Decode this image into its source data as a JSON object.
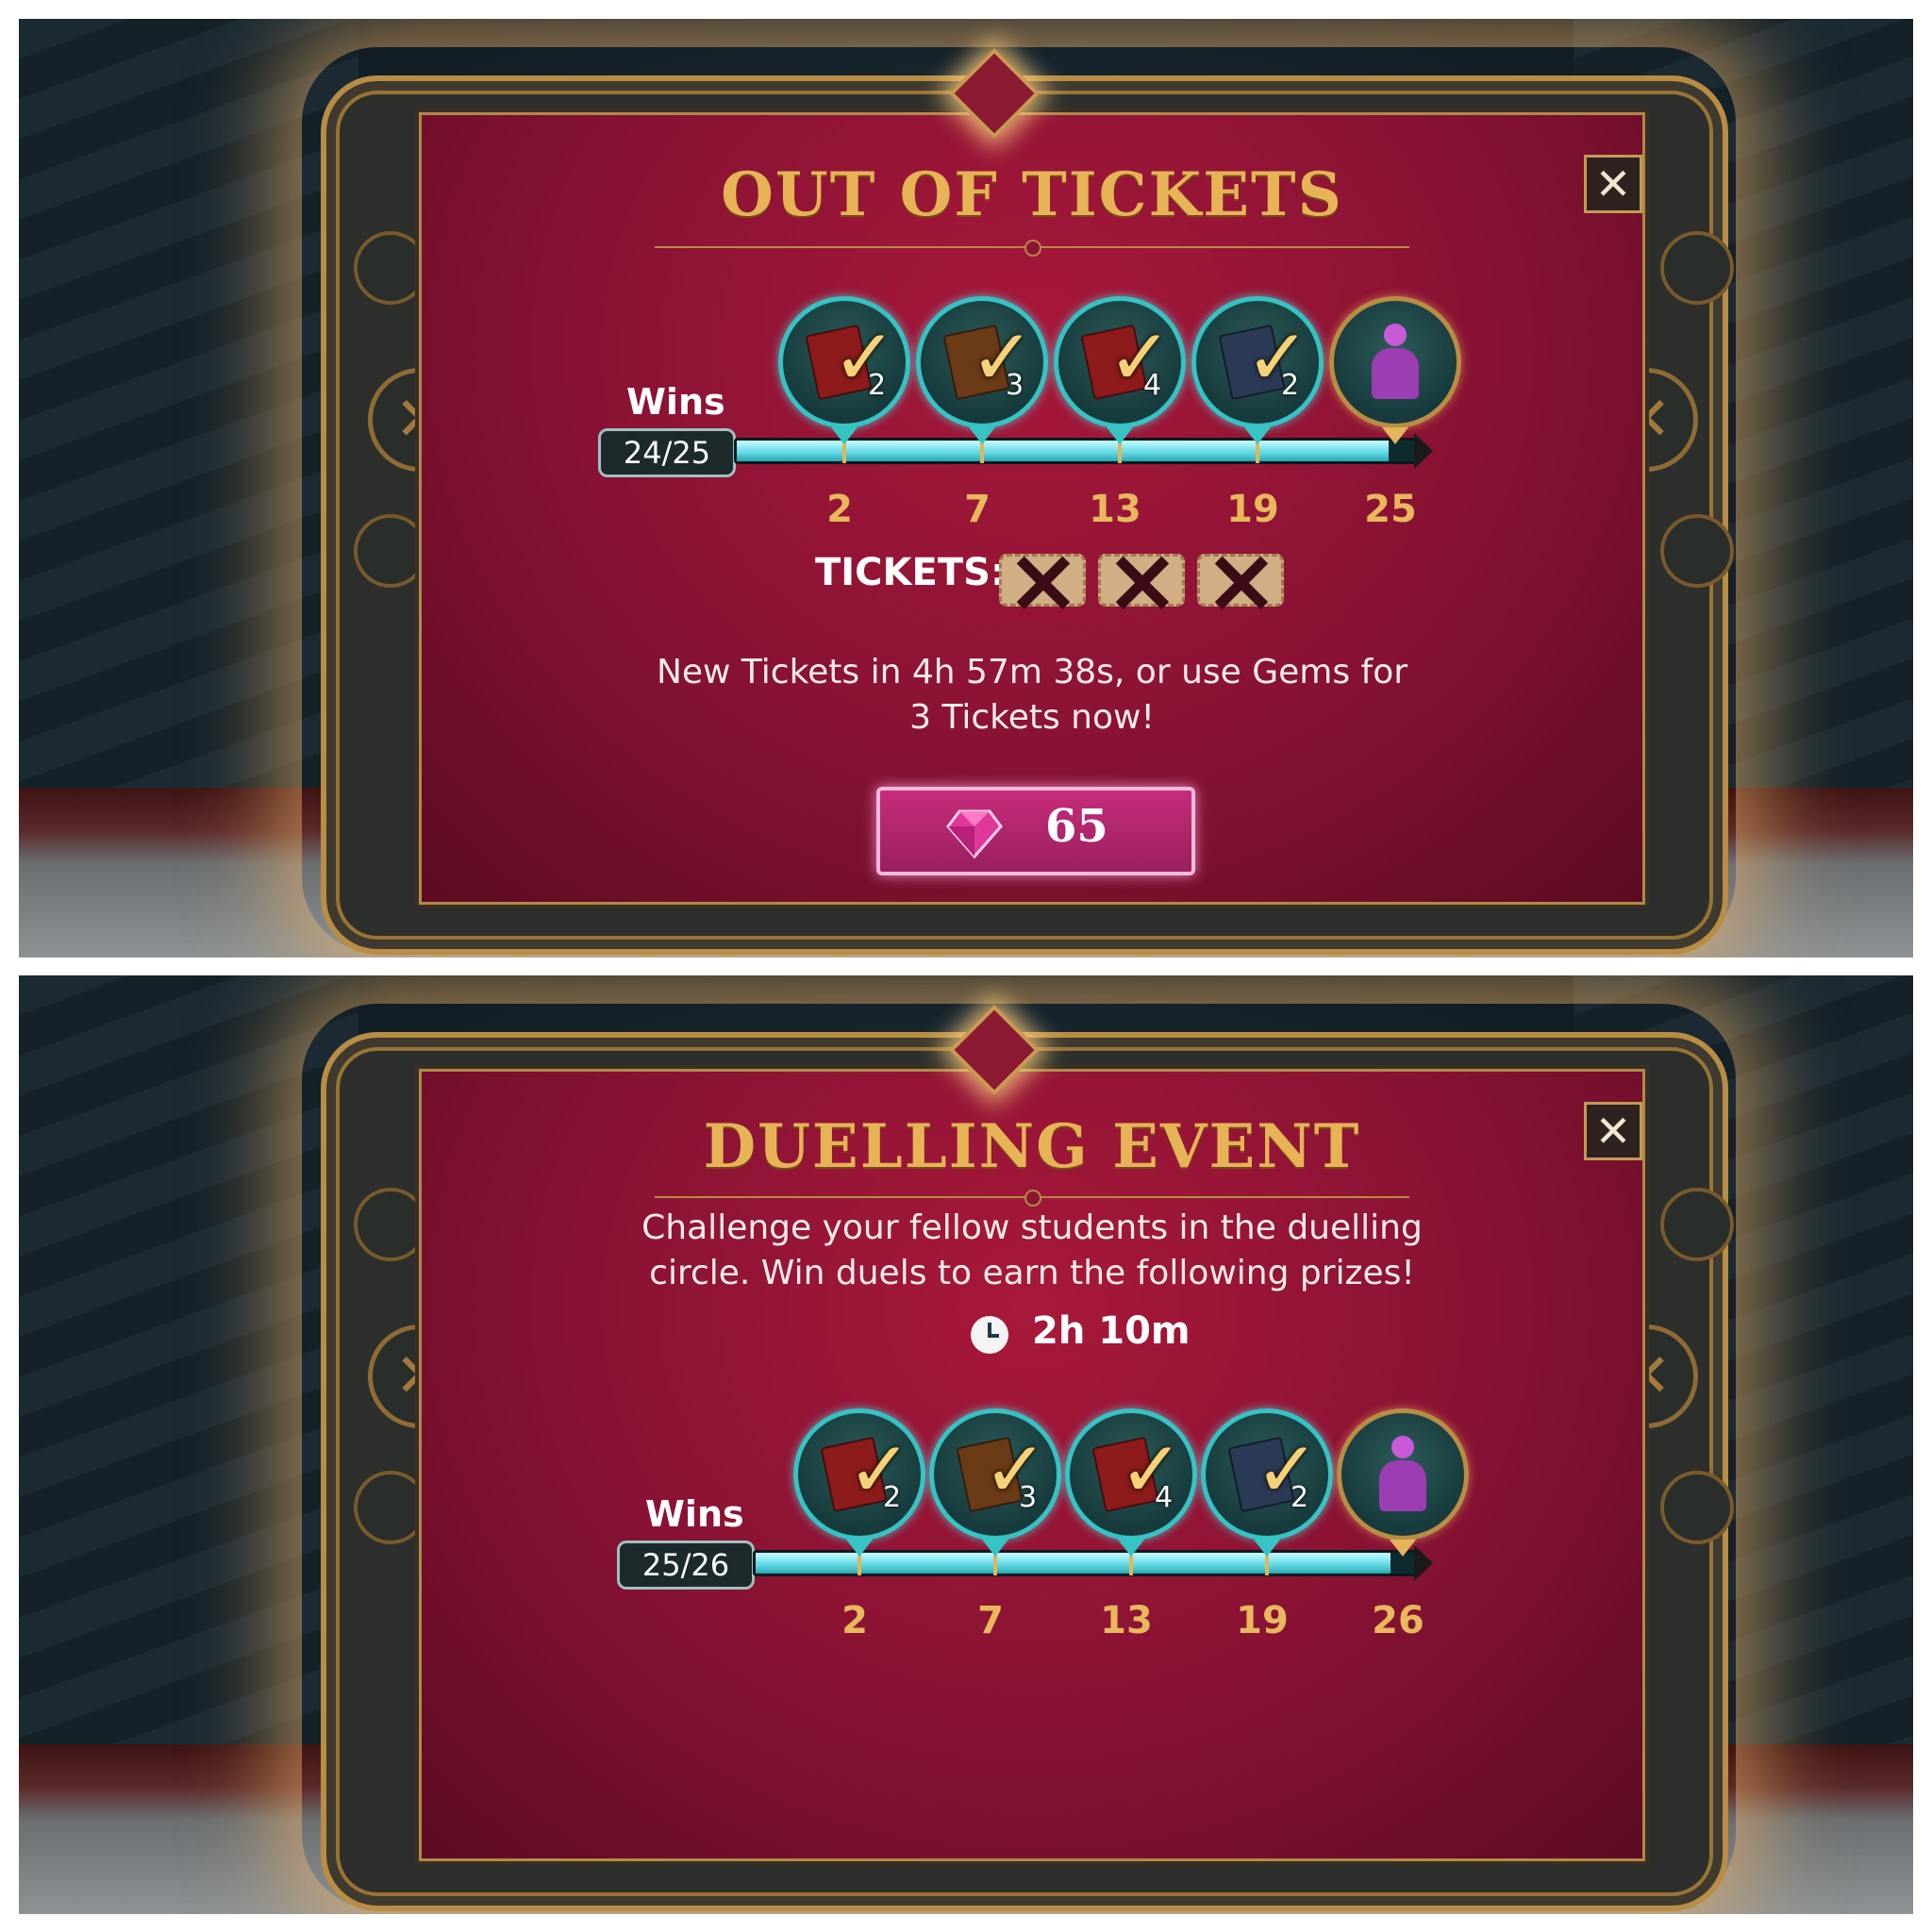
{
  "screens": [
    {
      "title": "OUT OF TICKETS",
      "close_label": "✕",
      "wins_label": "Wins",
      "wins_value": "24/25",
      "progress_fraction": 0.96,
      "milestones": [
        "2",
        "7",
        "13",
        "19",
        "25"
      ],
      "rewards": [
        {
          "count": "2",
          "icon": "red-book-check-icon",
          "color": "#8d1b1b"
        },
        {
          "count": "3",
          "icon": "brown-book-check-icon",
          "color": "#6b3a17"
        },
        {
          "count": "4",
          "icon": "red-book-check-icon",
          "color": "#8d1b1b"
        },
        {
          "count": "2",
          "icon": "blue-book-check-icon",
          "color": "#2b3a55"
        },
        {
          "icon": "purple-duellist-figure-icon"
        }
      ],
      "tickets_label": "TICKETS:",
      "tickets_used": 3,
      "message": "New Tickets in 4h 57m 38s, or use Gems for 3 Tickets now!",
      "gem_button_value": "65"
    },
    {
      "title": "DUELLING EVENT",
      "close_label": "✕",
      "description": "Challenge your fellow students in the duelling circle. Win duels to earn the following prizes!",
      "timer": "2h 10m",
      "wins_label": "Wins",
      "wins_value": "25/26",
      "progress_fraction": 0.962,
      "milestones": [
        "2",
        "7",
        "13",
        "19",
        "26"
      ],
      "rewards": [
        {
          "count": "2",
          "icon": "red-book-check-icon",
          "color": "#8d1b1b"
        },
        {
          "count": "3",
          "icon": "brown-book-check-icon",
          "color": "#6b3a17"
        },
        {
          "count": "4",
          "icon": "red-book-check-icon",
          "color": "#8d1b1b"
        },
        {
          "count": "2",
          "icon": "blue-book-check-icon",
          "color": "#2b3a55"
        },
        {
          "icon": "purple-duellist-figure-icon"
        }
      ]
    }
  ],
  "colors": {
    "gold": "#e6b457",
    "teal": "#35c3c4",
    "panel_red": "#861233",
    "gem_pink": "#c72d7c"
  }
}
